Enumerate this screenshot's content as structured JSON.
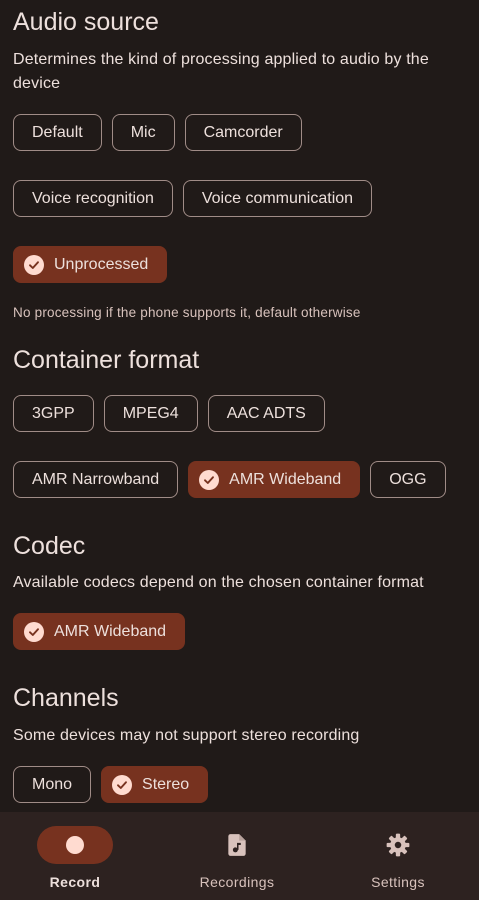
{
  "audio_source": {
    "title": "Audio source",
    "description": "Determines the kind of processing applied to audio by the device",
    "options": [
      "Default",
      "Mic",
      "Camcorder",
      "Voice recognition",
      "Voice communication",
      "Unprocessed"
    ],
    "selected": "Unprocessed",
    "hint": "No processing if the phone supports it, default otherwise"
  },
  "container_format": {
    "title": "Container format",
    "options": [
      "3GPP",
      "MPEG4",
      "AAC ADTS",
      "AMR Narrowband",
      "AMR Wideband",
      "OGG"
    ],
    "selected": "AMR Wideband"
  },
  "codec": {
    "title": "Codec",
    "description": "Available codecs depend on the chosen container format",
    "options": [
      "AMR Wideband"
    ],
    "selected": "AMR Wideband"
  },
  "channels": {
    "title": "Channels",
    "description": "Some devices may not support stereo recording",
    "options": [
      "Mono",
      "Stereo"
    ],
    "selected": "Stereo"
  },
  "chip_check_icon": "check-circle-icon",
  "nav": {
    "items": [
      {
        "label": "Record",
        "icon": "record-dot-icon",
        "active": true
      },
      {
        "label": "Recordings",
        "icon": "music-file-icon",
        "active": false
      },
      {
        "label": "Settings",
        "icon": "gear-icon",
        "active": false
      }
    ]
  },
  "colors": {
    "background": "#201a18",
    "selected_chip": "#77321f",
    "nav_background": "#2d2220",
    "text": "#ede0dc"
  }
}
